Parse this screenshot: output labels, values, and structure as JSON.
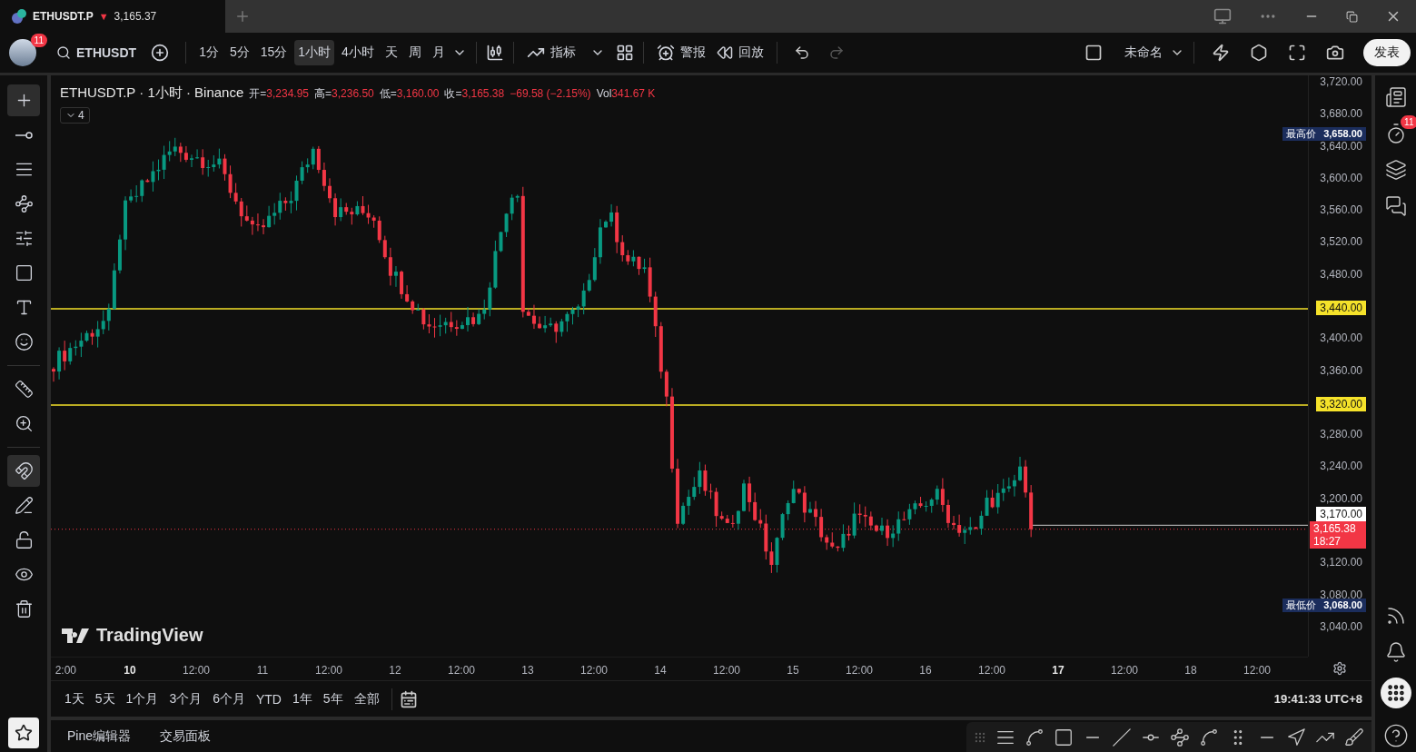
{
  "window": {
    "tab": {
      "symbol": "ETHUSDT.P",
      "arrow": "▼",
      "price": "3,165.37"
    }
  },
  "toolbar": {
    "avatar_badge": "11",
    "symbol": "ETHUSDT",
    "intervals": [
      {
        "label": "1分",
        "selected": false
      },
      {
        "label": "5分",
        "selected": false
      },
      {
        "label": "15分",
        "selected": false
      },
      {
        "label": "1小时",
        "selected": true
      },
      {
        "label": "4小时",
        "selected": false
      },
      {
        "label": "天",
        "selected": false
      },
      {
        "label": "周",
        "selected": false
      },
      {
        "label": "月",
        "selected": false
      }
    ],
    "indicators_label": "指标",
    "alerts_label": "警报",
    "replay_label": "回放",
    "redo_disabled": true,
    "layout_name": "未命名",
    "publish_label": "发表"
  },
  "legend": {
    "title": "ETHUSDT.P · 1小时 · Binance",
    "fields": [
      {
        "label": "开=",
        "value": "3,234.95"
      },
      {
        "label": "高=",
        "value": "3,236.50"
      },
      {
        "label": "低=",
        "value": "3,160.00"
      },
      {
        "label": "收=",
        "value": "3,165.38"
      }
    ],
    "change": "−69.58 (−2.15%)",
    "volume_label": "Vol",
    "volume_value": "341.67 K",
    "collapsed_count": "4"
  },
  "price_axis": {
    "upper_labels": [
      "3,720.00",
      "3,680.00",
      "3,640.00",
      "3,600.00",
      "3,560.00",
      "3,520.00",
      "3,480.00"
    ],
    "middle_labels": [
      "3,400.00",
      "3,360.00"
    ],
    "lower_labels": [
      "3,280.00",
      "3,240.00",
      "3,200.00"
    ],
    "bottom_labels": [
      "3,120.00",
      "3,080.00",
      "3,040.00"
    ],
    "lines": [
      {
        "value": "3,440.00"
      },
      {
        "value": "3,320.00"
      }
    ],
    "high": {
      "tag": "最高价",
      "value": "3,658.00"
    },
    "low": {
      "tag": "最低价",
      "value": "3,068.00"
    },
    "crosshair_value": "3,170.00",
    "last": {
      "price": "3,165.38",
      "countdown": "18:27"
    }
  },
  "time_axis": {
    "labels": [
      {
        "text": "2:00",
        "bold": false
      },
      {
        "text": "10",
        "bold": true
      },
      {
        "text": "12:00",
        "bold": false
      },
      {
        "text": "11",
        "bold": false
      },
      {
        "text": "12:00",
        "bold": false
      },
      {
        "text": "12",
        "bold": false
      },
      {
        "text": "12:00",
        "bold": false
      },
      {
        "text": "13",
        "bold": false
      },
      {
        "text": "12:00",
        "bold": false
      },
      {
        "text": "14",
        "bold": false
      },
      {
        "text": "12:00",
        "bold": false
      },
      {
        "text": "15",
        "bold": false
      },
      {
        "text": "12:00",
        "bold": false
      },
      {
        "text": "16",
        "bold": false
      },
      {
        "text": "12:00",
        "bold": false
      },
      {
        "text": "17",
        "bold": true
      },
      {
        "text": "12:00",
        "bold": false
      },
      {
        "text": "18",
        "bold": false
      },
      {
        "text": "12:00",
        "bold": false
      }
    ]
  },
  "watermark": "TradingView",
  "range_bar": {
    "ranges": [
      "1天",
      "5天",
      "1个月",
      "3个月",
      "6个月",
      "YTD",
      "1年",
      "5年",
      "全部"
    ],
    "clock": "19:41:33 UTC+8"
  },
  "bottom_tabs": [
    "Pine编辑器",
    "交易面板"
  ],
  "left_toolbar": {
    "tools": [
      {
        "selected": true
      },
      {
        "selected": false
      },
      {
        "selected": false
      },
      {
        "selected": false
      },
      {
        "selected": false
      },
      {
        "selected": false
      },
      {
        "selected": false
      },
      {
        "selected": false
      },
      {
        "selected": false
      },
      {
        "selected": false
      },
      {
        "selected": true
      },
      {
        "selected": false
      },
      {
        "selected": false
      },
      {
        "selected": false
      },
      {
        "selected": false
      }
    ]
  },
  "right_sidebar": {
    "alerts_badge": "11"
  }
}
